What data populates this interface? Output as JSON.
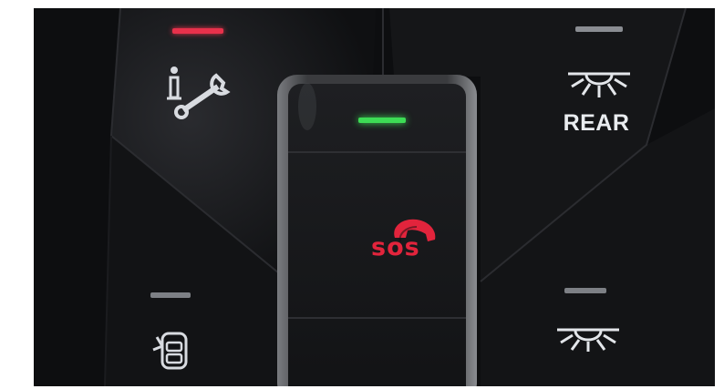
{
  "buttons": {
    "info_service": {
      "led_color": "#e8314b"
    },
    "rear_light": {
      "label": "REAR",
      "led_color": "#8a8d92"
    },
    "sos": {
      "label": "SOS",
      "led_color": "#3ddc55",
      "accent_color": "#e2243c"
    },
    "door_lock": {
      "led_color": "#7d8085"
    },
    "interior_light": {
      "led_color": "#7d8085"
    }
  }
}
